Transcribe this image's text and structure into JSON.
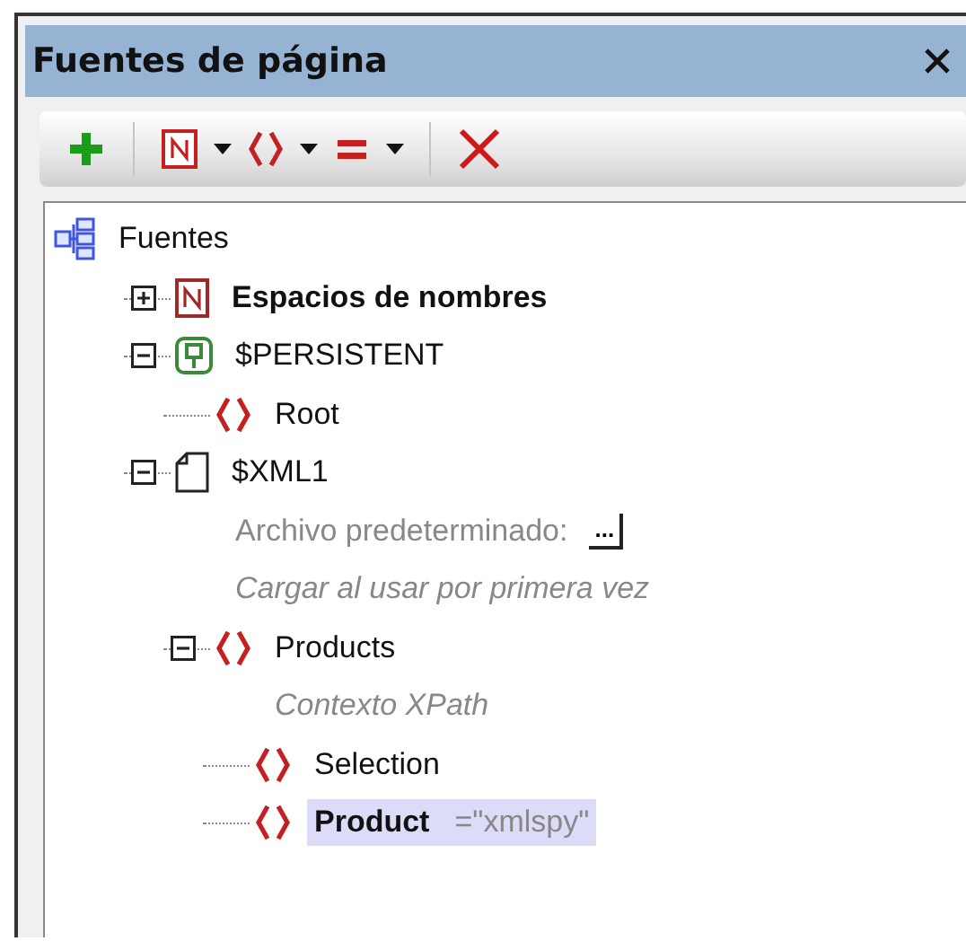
{
  "window": {
    "title": "Fuentes de página"
  },
  "toolbar": [
    {
      "kind": "add"
    },
    {
      "kind": "separator"
    },
    {
      "kind": "namespace"
    },
    {
      "kind": "dropdown"
    },
    {
      "kind": "element"
    },
    {
      "kind": "dropdown"
    },
    {
      "kind": "equals"
    },
    {
      "kind": "dropdown"
    },
    {
      "kind": "separator"
    },
    {
      "kind": "delete"
    }
  ],
  "tree": {
    "label": "Fuentes",
    "kind": "sources",
    "selected": false,
    "children": [
      {
        "label": "Espacios de nombres",
        "kind": "namespaces",
        "bold": true,
        "expanded": false,
        "selected": false
      },
      {
        "label": "$PERSISTENT",
        "kind": "persistent",
        "bold": false,
        "expanded": true,
        "selected": false,
        "children": [
          {
            "label": "Root",
            "kind": "element",
            "bold": false,
            "selected": false
          }
        ]
      },
      {
        "label": "$XML1",
        "kind": "document",
        "bold": false,
        "expanded": true,
        "selected": false,
        "details": [
          {
            "kind": "setting",
            "text": "Archivo predeterminado:",
            "button": "..."
          },
          {
            "kind": "note",
            "text": "Cargar al usar por primera vez"
          }
        ],
        "children": [
          {
            "label": "Products",
            "kind": "element",
            "bold": false,
            "expanded": true,
            "selected": false,
            "details": [
              {
                "kind": "note",
                "text": "Contexto XPath"
              }
            ],
            "children": [
              {
                "label": "Selection",
                "kind": "element",
                "bold": false,
                "selected": false
              },
              {
                "label": "Product",
                "kind": "element",
                "bold": true,
                "selected": true,
                "value": "=\"xmlspy\""
              }
            ]
          }
        ]
      }
    ]
  }
}
